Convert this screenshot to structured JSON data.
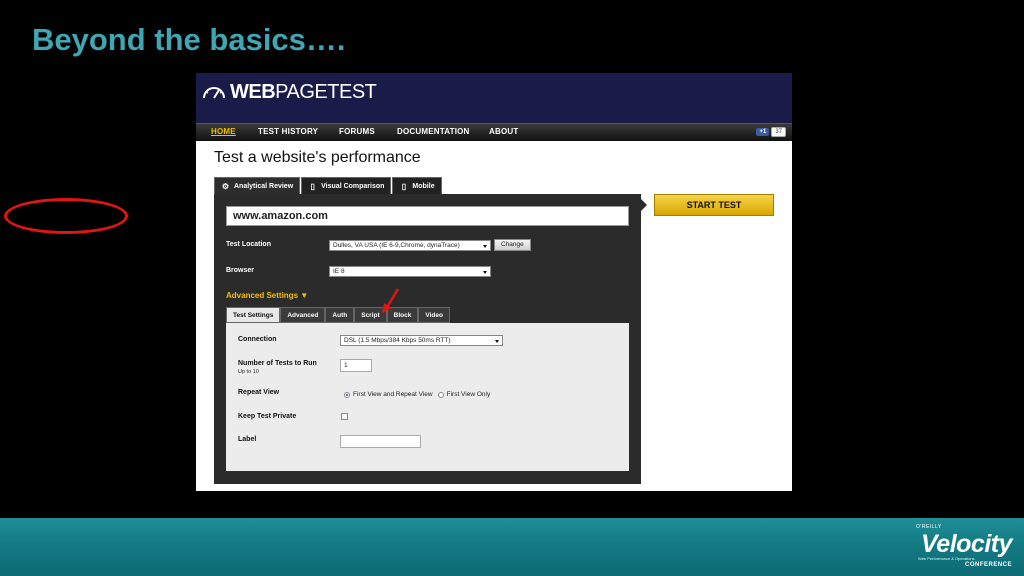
{
  "slide": {
    "title": "Beyond the basics….",
    "logo": {
      "publisher": "O'REILLY",
      "brand": "Velocity",
      "tagline": "Web Performance & Operations",
      "conference": "CONFERENCE"
    }
  },
  "wpt": {
    "logo_bold": "WEB",
    "logo_thin": "PAGETEST",
    "nav": [
      "HOME",
      "TEST HISTORY",
      "FORUMS",
      "DOCUMENTATION",
      "ABOUT"
    ],
    "social": {
      "like": "+1",
      "count": "37"
    },
    "page_heading": "Test a website's performance",
    "main_tabs": [
      "Analytical Review",
      "Visual Comparison",
      "Mobile"
    ],
    "url_value": "www.amazon.com",
    "start_test_label": "START TEST",
    "test_location": {
      "label": "Test Location",
      "value": "Dulles, VA USA (IE 6-9,Chrome, dynaTrace)",
      "button": "Change"
    },
    "browser": {
      "label": "Browser",
      "value": "IE 8"
    },
    "advanced_toggle": "Advanced Settings ▼",
    "sub_tabs": [
      "Test Settings",
      "Advanced",
      "Auth",
      "Script",
      "Block",
      "Video"
    ],
    "settings": {
      "connection": {
        "label": "Connection",
        "value": "DSL (1.5 Mbps/384 Kbps 50ms RTT)"
      },
      "num_tests": {
        "label": "Number of Tests to Run",
        "sub": "Up to 10",
        "value": "1"
      },
      "repeat_view": {
        "label": "Repeat View",
        "option1": "First View and Repeat View",
        "option2": "First View Only"
      },
      "keep_private": {
        "label": "Keep Test Private"
      },
      "label": {
        "label": "Label",
        "value": ""
      }
    }
  },
  "colors": {
    "accent_yellow": "#f2c000",
    "annotation_red": "#e21414",
    "title_teal": "#3fa6b3"
  }
}
